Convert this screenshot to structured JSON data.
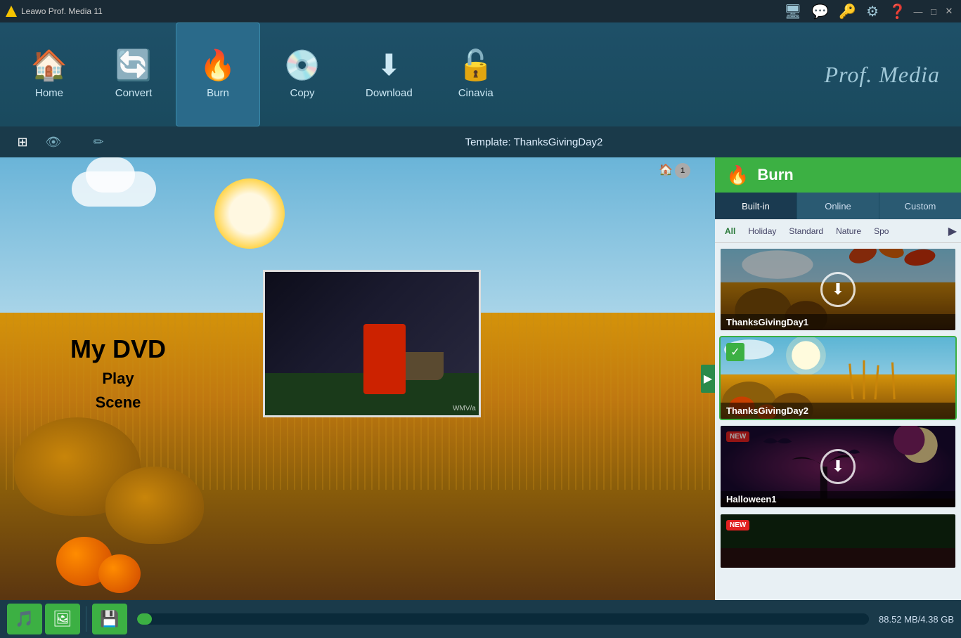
{
  "app": {
    "title": "Leawo Prof. Media 11",
    "logo_text": "Prof. Media"
  },
  "window_controls": {
    "minimize": "—",
    "maximize": "□",
    "close": "✕"
  },
  "toolbar": {
    "items": [
      {
        "id": "home",
        "label": "Home",
        "icon": "🏠"
      },
      {
        "id": "convert",
        "label": "Convert",
        "icon": "🔄"
      },
      {
        "id": "burn",
        "label": "Burn",
        "icon": "🔥"
      },
      {
        "id": "copy",
        "label": "Copy",
        "icon": "💿"
      },
      {
        "id": "download",
        "label": "Download",
        "icon": "⬇"
      },
      {
        "id": "cinavia",
        "label": "Cinavia",
        "icon": "🔓"
      }
    ]
  },
  "secondary_bar": {
    "btns": [
      "⊞",
      "👁",
      "✏"
    ],
    "template_label": "Template: ThanksGivingDay2"
  },
  "preview": {
    "dvd_title": "My DVD",
    "dvd_play": "Play",
    "dvd_scene": "Scene",
    "watermark": "WMV/a"
  },
  "right_panel": {
    "burn_label": "Burn",
    "tabs": [
      "Built-in",
      "Online",
      "Custom"
    ],
    "active_tab": "Built-in",
    "filters": [
      "All",
      "Holiday",
      "Standard",
      "Nature",
      "Spo"
    ],
    "active_filter": "All",
    "templates": [
      {
        "id": "thanksgiving1",
        "label": "ThanksGivingDay1",
        "badge": "download",
        "selected": false
      },
      {
        "id": "thanksgiving2",
        "label": "ThanksGivingDay2",
        "badge": "check",
        "selected": true
      },
      {
        "id": "halloween1",
        "label": "Halloween1",
        "badge": "new_download",
        "selected": false
      },
      {
        "id": "halloween2",
        "label": "",
        "badge": "new",
        "selected": false
      }
    ]
  },
  "status_bar": {
    "storage": "88.52 MB/4.38 GB",
    "progress_pct": 2
  }
}
